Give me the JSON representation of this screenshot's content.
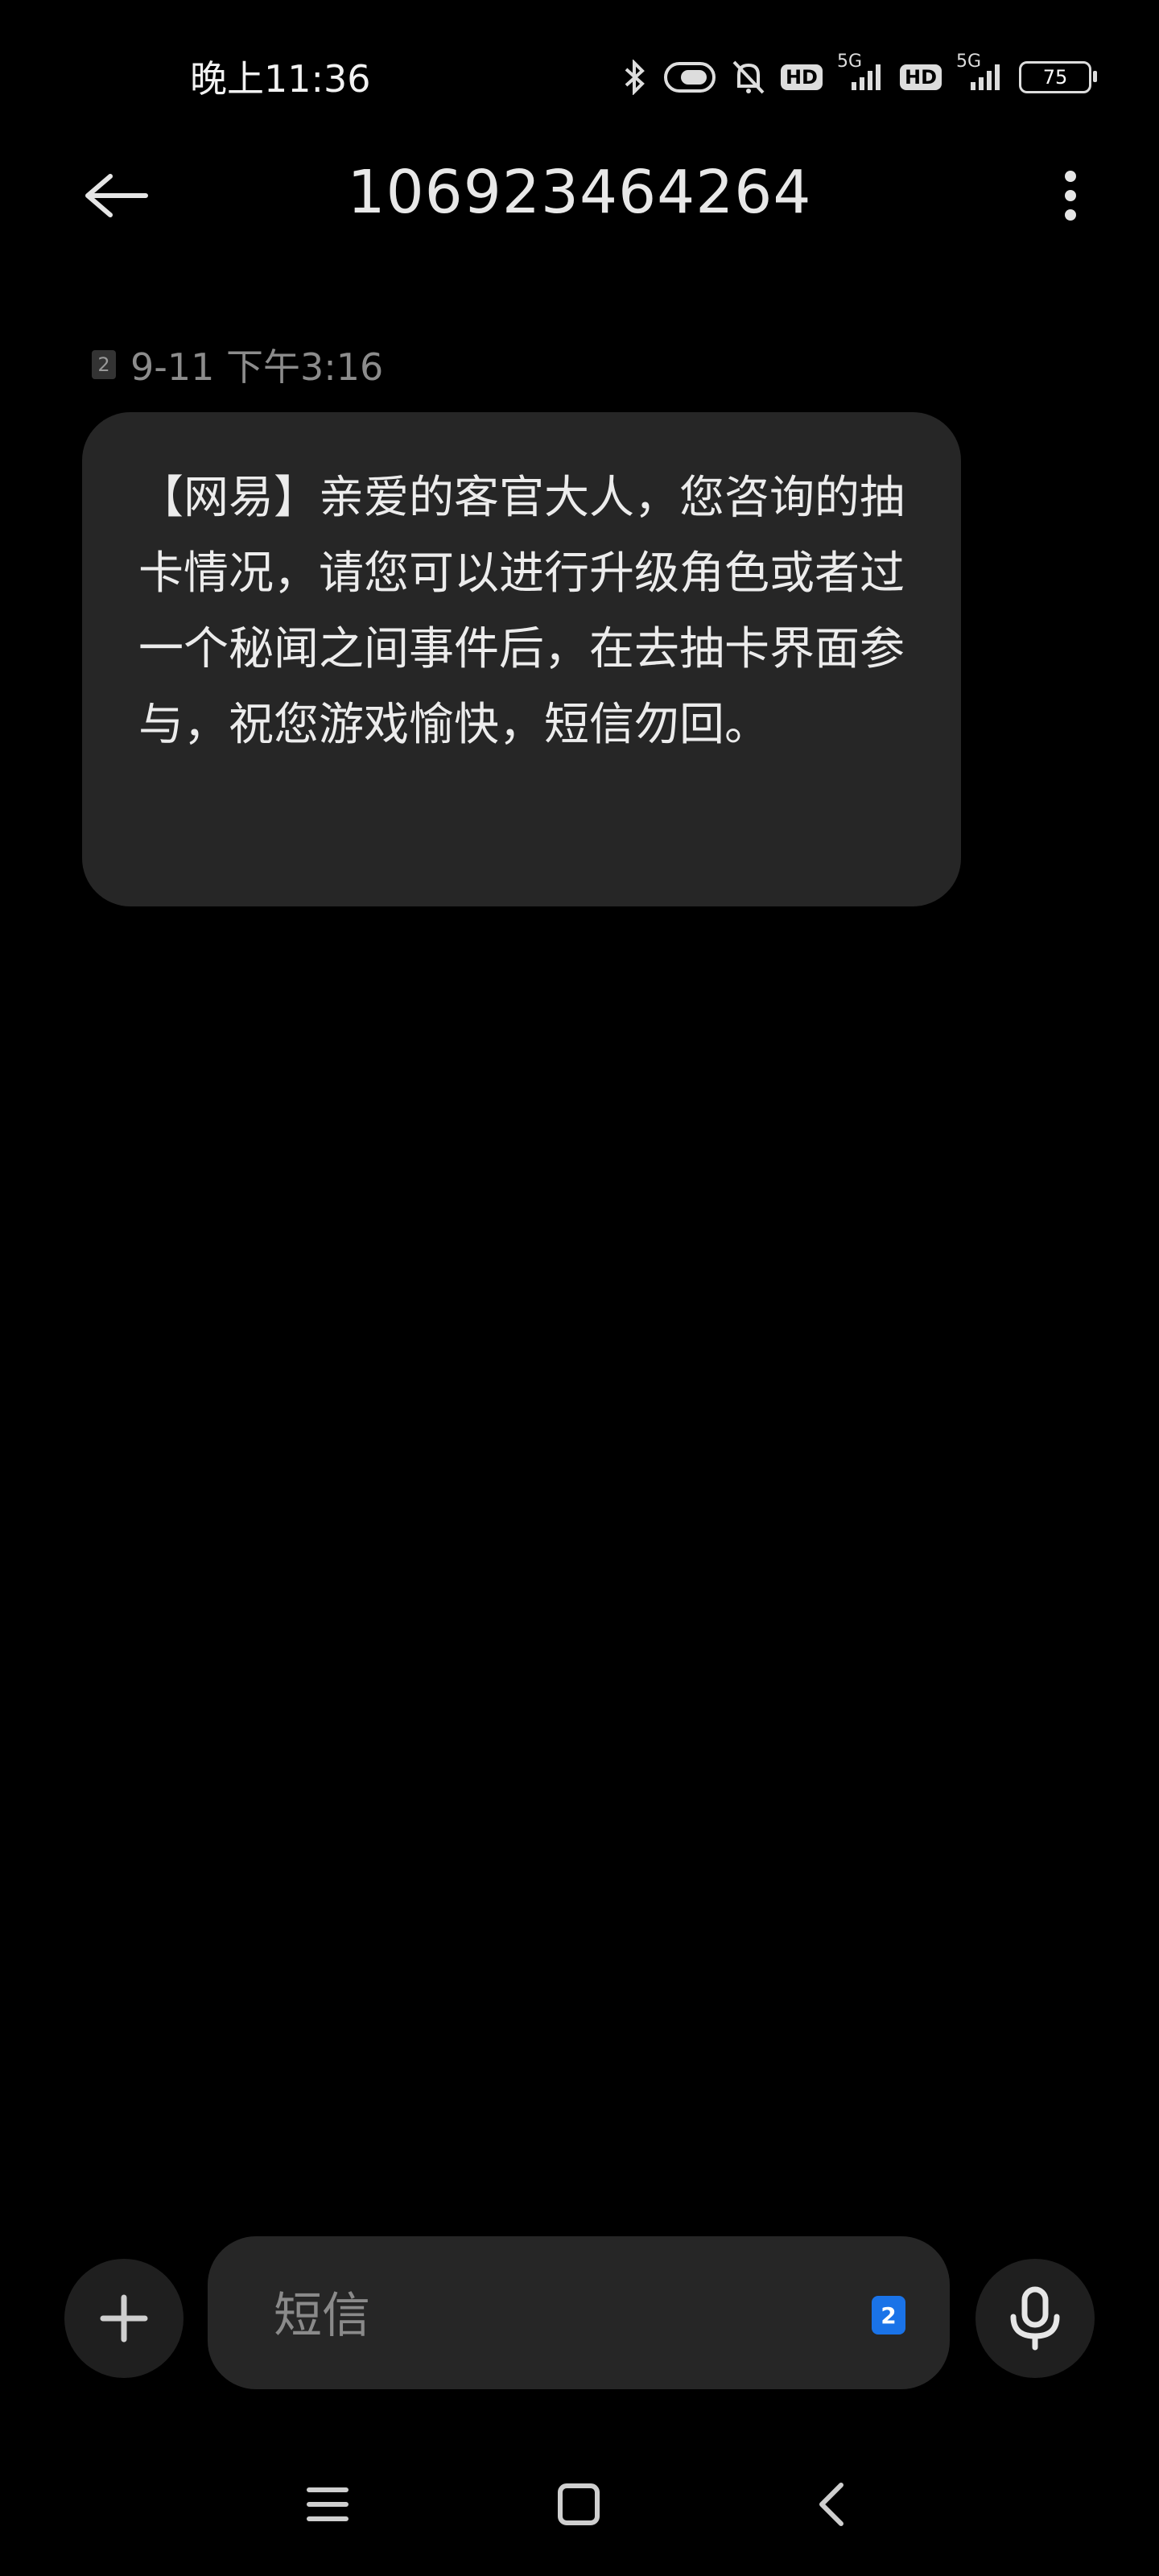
{
  "status_bar": {
    "time": "晚上11:36",
    "hd1": "HD",
    "net1": "5G",
    "hd2": "HD",
    "net2": "5G",
    "battery": "75"
  },
  "header": {
    "title": "106923464264"
  },
  "message": {
    "sim": "2",
    "date": "9-11 下午3:16",
    "text": "【网易】亲爱的客官大人，您咨询的抽卡情况，请您可以进行升级角色或者过一个秘闻之间事件后，在去抽卡界面参与，祝您游戏愉快，短信勿回。"
  },
  "composer": {
    "placeholder": "短信",
    "sim_badge": "2"
  },
  "icons": {
    "back": "arrow-left-icon",
    "more": "more-vertical-icon",
    "add": "plus-icon",
    "mic": "microphone-icon",
    "nav_menu": "menu-icon",
    "nav_home": "home-square-icon",
    "nav_back": "chevron-left-icon"
  },
  "colors": {
    "background": "#000000",
    "bubble": "#262626",
    "accent_badge": "#1a73e8"
  }
}
